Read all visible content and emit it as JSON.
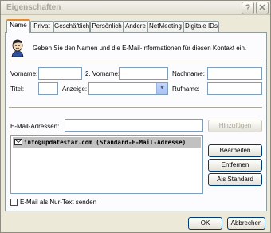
{
  "window": {
    "title": "Eigenschaften",
    "help_label": "?",
    "close_label": "✕"
  },
  "tabs": [
    {
      "label": "Name"
    },
    {
      "label": "Privat"
    },
    {
      "label": "Geschäftlich"
    },
    {
      "label": "Persönlich"
    },
    {
      "label": "Andere"
    },
    {
      "label": "NetMeeting"
    },
    {
      "label": "Digitale IDs"
    }
  ],
  "intro": {
    "text": "Geben Sie den Namen und die E-Mail-Informationen für diesen Kontakt ein."
  },
  "name_fields": {
    "vorname_label": "Vorname:",
    "zweiter_vorname_label": "2. Vorname:",
    "nachname_label": "Nachname:",
    "titel_label": "Titel:",
    "anzeige_label": "Anzeige:",
    "rufname_label": "Rufname:"
  },
  "email": {
    "label": "E-Mail-Adressen:",
    "add_label": "Hinzufügen",
    "entries": [
      {
        "address": "info@updatestar.com  (Standard-E-Mail-Adresse)"
      }
    ],
    "edit_label": "Bearbeiten",
    "remove_label": "Entfernen",
    "default_label": "Als Standard",
    "plain_text_label": "E-Mail als Nur-Text senden"
  },
  "footer": {
    "ok_label": "OK",
    "cancel_label": "Abbrechen"
  }
}
